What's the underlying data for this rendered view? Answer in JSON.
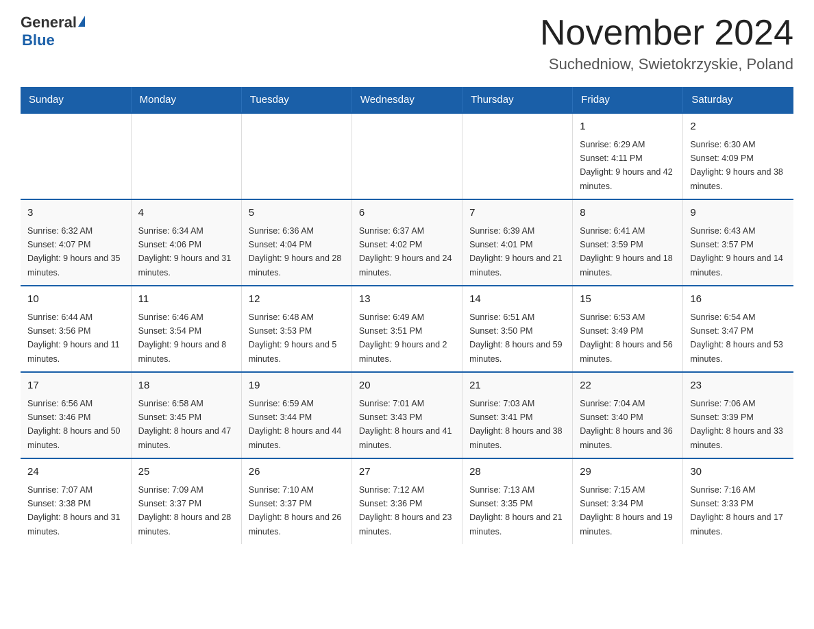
{
  "header": {
    "logo_general": "General",
    "logo_blue": "Blue",
    "month_title": "November 2024",
    "location": "Suchedniow, Swietokrzyskie, Poland"
  },
  "weekdays": [
    "Sunday",
    "Monday",
    "Tuesday",
    "Wednesday",
    "Thursday",
    "Friday",
    "Saturday"
  ],
  "weeks": [
    [
      {
        "day": "",
        "info": ""
      },
      {
        "day": "",
        "info": ""
      },
      {
        "day": "",
        "info": ""
      },
      {
        "day": "",
        "info": ""
      },
      {
        "day": "",
        "info": ""
      },
      {
        "day": "1",
        "info": "Sunrise: 6:29 AM\nSunset: 4:11 PM\nDaylight: 9 hours and 42 minutes."
      },
      {
        "day": "2",
        "info": "Sunrise: 6:30 AM\nSunset: 4:09 PM\nDaylight: 9 hours and 38 minutes."
      }
    ],
    [
      {
        "day": "3",
        "info": "Sunrise: 6:32 AM\nSunset: 4:07 PM\nDaylight: 9 hours and 35 minutes."
      },
      {
        "day": "4",
        "info": "Sunrise: 6:34 AM\nSunset: 4:06 PM\nDaylight: 9 hours and 31 minutes."
      },
      {
        "day": "5",
        "info": "Sunrise: 6:36 AM\nSunset: 4:04 PM\nDaylight: 9 hours and 28 minutes."
      },
      {
        "day": "6",
        "info": "Sunrise: 6:37 AM\nSunset: 4:02 PM\nDaylight: 9 hours and 24 minutes."
      },
      {
        "day": "7",
        "info": "Sunrise: 6:39 AM\nSunset: 4:01 PM\nDaylight: 9 hours and 21 minutes."
      },
      {
        "day": "8",
        "info": "Sunrise: 6:41 AM\nSunset: 3:59 PM\nDaylight: 9 hours and 18 minutes."
      },
      {
        "day": "9",
        "info": "Sunrise: 6:43 AM\nSunset: 3:57 PM\nDaylight: 9 hours and 14 minutes."
      }
    ],
    [
      {
        "day": "10",
        "info": "Sunrise: 6:44 AM\nSunset: 3:56 PM\nDaylight: 9 hours and 11 minutes."
      },
      {
        "day": "11",
        "info": "Sunrise: 6:46 AM\nSunset: 3:54 PM\nDaylight: 9 hours and 8 minutes."
      },
      {
        "day": "12",
        "info": "Sunrise: 6:48 AM\nSunset: 3:53 PM\nDaylight: 9 hours and 5 minutes."
      },
      {
        "day": "13",
        "info": "Sunrise: 6:49 AM\nSunset: 3:51 PM\nDaylight: 9 hours and 2 minutes."
      },
      {
        "day": "14",
        "info": "Sunrise: 6:51 AM\nSunset: 3:50 PM\nDaylight: 8 hours and 59 minutes."
      },
      {
        "day": "15",
        "info": "Sunrise: 6:53 AM\nSunset: 3:49 PM\nDaylight: 8 hours and 56 minutes."
      },
      {
        "day": "16",
        "info": "Sunrise: 6:54 AM\nSunset: 3:47 PM\nDaylight: 8 hours and 53 minutes."
      }
    ],
    [
      {
        "day": "17",
        "info": "Sunrise: 6:56 AM\nSunset: 3:46 PM\nDaylight: 8 hours and 50 minutes."
      },
      {
        "day": "18",
        "info": "Sunrise: 6:58 AM\nSunset: 3:45 PM\nDaylight: 8 hours and 47 minutes."
      },
      {
        "day": "19",
        "info": "Sunrise: 6:59 AM\nSunset: 3:44 PM\nDaylight: 8 hours and 44 minutes."
      },
      {
        "day": "20",
        "info": "Sunrise: 7:01 AM\nSunset: 3:43 PM\nDaylight: 8 hours and 41 minutes."
      },
      {
        "day": "21",
        "info": "Sunrise: 7:03 AM\nSunset: 3:41 PM\nDaylight: 8 hours and 38 minutes."
      },
      {
        "day": "22",
        "info": "Sunrise: 7:04 AM\nSunset: 3:40 PM\nDaylight: 8 hours and 36 minutes."
      },
      {
        "day": "23",
        "info": "Sunrise: 7:06 AM\nSunset: 3:39 PM\nDaylight: 8 hours and 33 minutes."
      }
    ],
    [
      {
        "day": "24",
        "info": "Sunrise: 7:07 AM\nSunset: 3:38 PM\nDaylight: 8 hours and 31 minutes."
      },
      {
        "day": "25",
        "info": "Sunrise: 7:09 AM\nSunset: 3:37 PM\nDaylight: 8 hours and 28 minutes."
      },
      {
        "day": "26",
        "info": "Sunrise: 7:10 AM\nSunset: 3:37 PM\nDaylight: 8 hours and 26 minutes."
      },
      {
        "day": "27",
        "info": "Sunrise: 7:12 AM\nSunset: 3:36 PM\nDaylight: 8 hours and 23 minutes."
      },
      {
        "day": "28",
        "info": "Sunrise: 7:13 AM\nSunset: 3:35 PM\nDaylight: 8 hours and 21 minutes."
      },
      {
        "day": "29",
        "info": "Sunrise: 7:15 AM\nSunset: 3:34 PM\nDaylight: 8 hours and 19 minutes."
      },
      {
        "day": "30",
        "info": "Sunrise: 7:16 AM\nSunset: 3:33 PM\nDaylight: 8 hours and 17 minutes."
      }
    ]
  ]
}
